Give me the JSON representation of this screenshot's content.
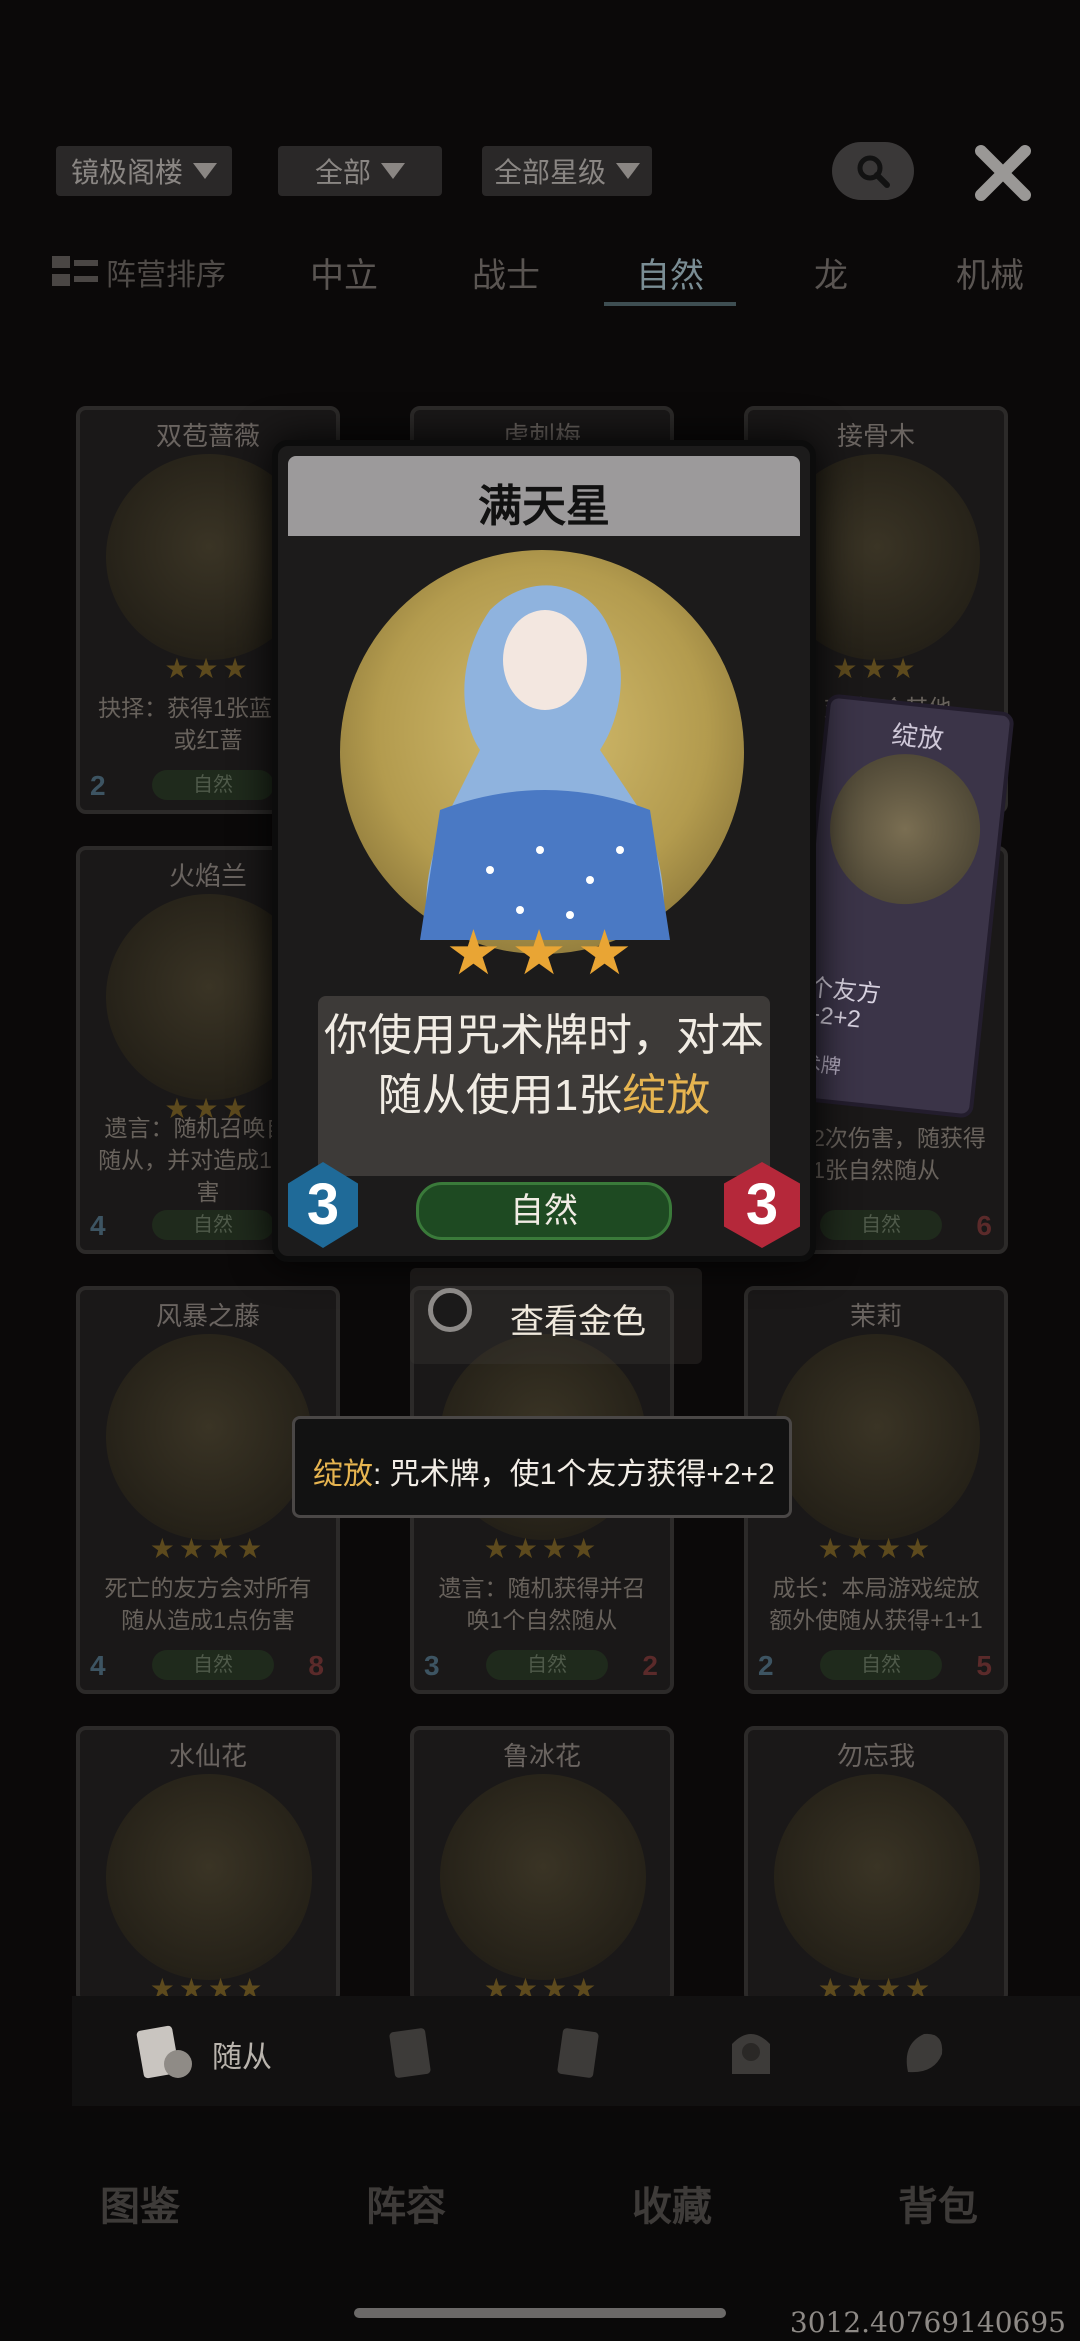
{
  "filters": [
    {
      "label": "镜极阁楼"
    },
    {
      "label": "全部"
    },
    {
      "label": "全部星级"
    }
  ],
  "tabs": {
    "sort_label": "阵营排序",
    "items": [
      "中立",
      "战士",
      "自然",
      "龙",
      "机械"
    ],
    "active": "自然"
  },
  "cards": [
    {
      "name": "双苞蔷薇",
      "stars": "★★★",
      "text": "抉择：获得1张蓝蔷薇或红蔷",
      "faction": "自然",
      "cost": "2",
      "attack": ""
    },
    {
      "name": "虎刺梅",
      "stars": "",
      "text": "",
      "faction": "",
      "cost": "",
      "attack": ""
    },
    {
      "name": "接骨木",
      "stars": "★★★",
      "text": "：对第1个其他",
      "faction": "",
      "cost": "",
      "attack": ""
    },
    {
      "name": "火焰兰",
      "stars": "★★★",
      "text": "遗言：随机召唤自然随从，并对造成1点伤害",
      "faction": "自然",
      "cost": "4",
      "attack": ""
    },
    {
      "name": "",
      "stars": "",
      "text": "受到2次伤害，随获得1张自然随从",
      "faction": "自然",
      "cost": "",
      "attack": "6"
    },
    {
      "name": "风暴之藤",
      "stars": "★★★★",
      "text": "死亡的友方会对所有随从造成1点伤害",
      "faction": "自然",
      "cost": "4",
      "attack": "8"
    },
    {
      "name": "",
      "stars": "★★★★",
      "text": "遗言：随机获得并召唤1个自然随从",
      "faction": "自然",
      "cost": "3",
      "attack": "2"
    },
    {
      "name": "茉莉",
      "stars": "★★★★",
      "text": "成长：本局游戏绽放额外使随从获得+1+1",
      "faction": "自然",
      "cost": "2",
      "attack": "5"
    },
    {
      "name": "水仙花",
      "stars": "★★★★",
      "text": "",
      "faction": "",
      "cost": "",
      "attack": ""
    },
    {
      "name": "鲁冰花",
      "stars": "★★★★",
      "text": "",
      "faction": "",
      "cost": "",
      "attack": ""
    },
    {
      "name": "勿忘我",
      "stars": "★★★★",
      "text": "",
      "faction": "",
      "cost": "",
      "attack": ""
    }
  ],
  "bloom_card": {
    "name": "绽放",
    "text_a": "个友方",
    "text_b": "+2+2",
    "text_c": "术牌"
  },
  "focus_card": {
    "name": "满天星",
    "stars": "★★★",
    "desc_prefix": "你使用咒术牌时，对本随从使用1张",
    "desc_keyword": "绽放",
    "faction": "自然",
    "cost": "3",
    "attack": "3"
  },
  "view_gold_label": "查看金色",
  "tooltip": {
    "keyword": "绽放",
    "text": ": 咒术牌，使1个友方获得+2+2"
  },
  "subtabs": {
    "active_label": "随从"
  },
  "nav": [
    "图鉴",
    "阵容",
    "收藏",
    "背包"
  ],
  "coord_readout": "3012.40769140695",
  "colors": {
    "accent_gold": "#e6b450",
    "cost_blue": "#1f6a98",
    "attack_red": "#b5283a",
    "faction_green": "#1e4a22"
  }
}
